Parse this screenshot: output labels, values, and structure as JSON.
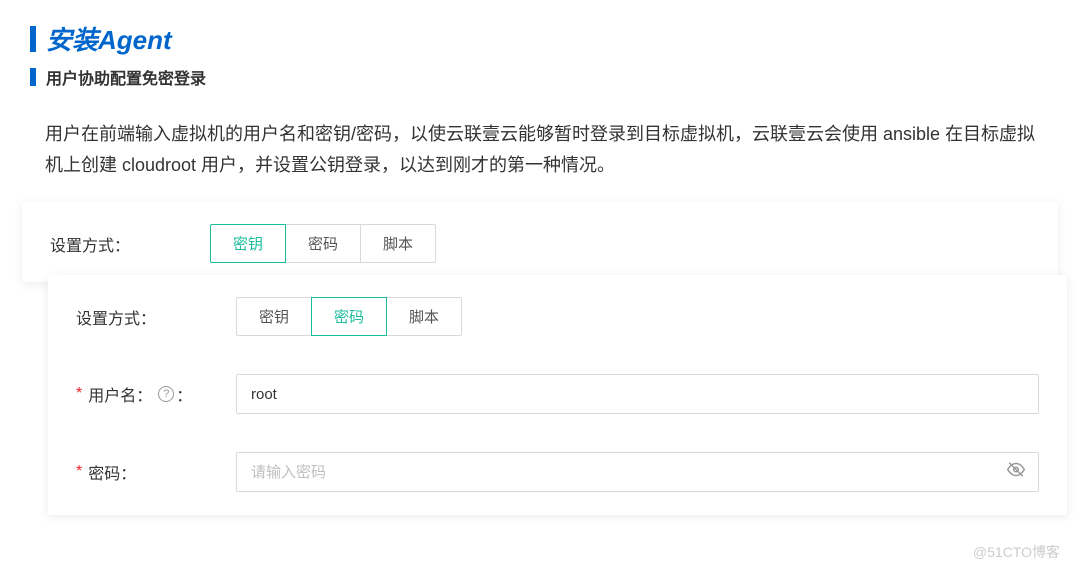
{
  "header": {
    "title": "安装Agent",
    "subtitle": "用户协助配置免密登录"
  },
  "description": "用户在前端输入虚拟机的用户名和密钥/密码，以使云联壹云能够暂时登录到目标虚拟机，云联壹云会使用 ansible 在目标虚拟机上创建 cloudroot 用户，并设置公钥登录，以达到刚才的第一种情况。",
  "panel_back": {
    "method_label": "设置方式：",
    "options": {
      "key": "密钥",
      "password": "密码",
      "script": "脚本"
    }
  },
  "panel_front": {
    "method_label": "设置方式：",
    "options": {
      "key": "密钥",
      "password": "密码",
      "script": "脚本"
    },
    "username_label": "用户名",
    "username_value": "root",
    "password_label": "密码",
    "password_placeholder": "请输入密码",
    "help_symbol": "?"
  },
  "watermark": "@51CTO博客"
}
